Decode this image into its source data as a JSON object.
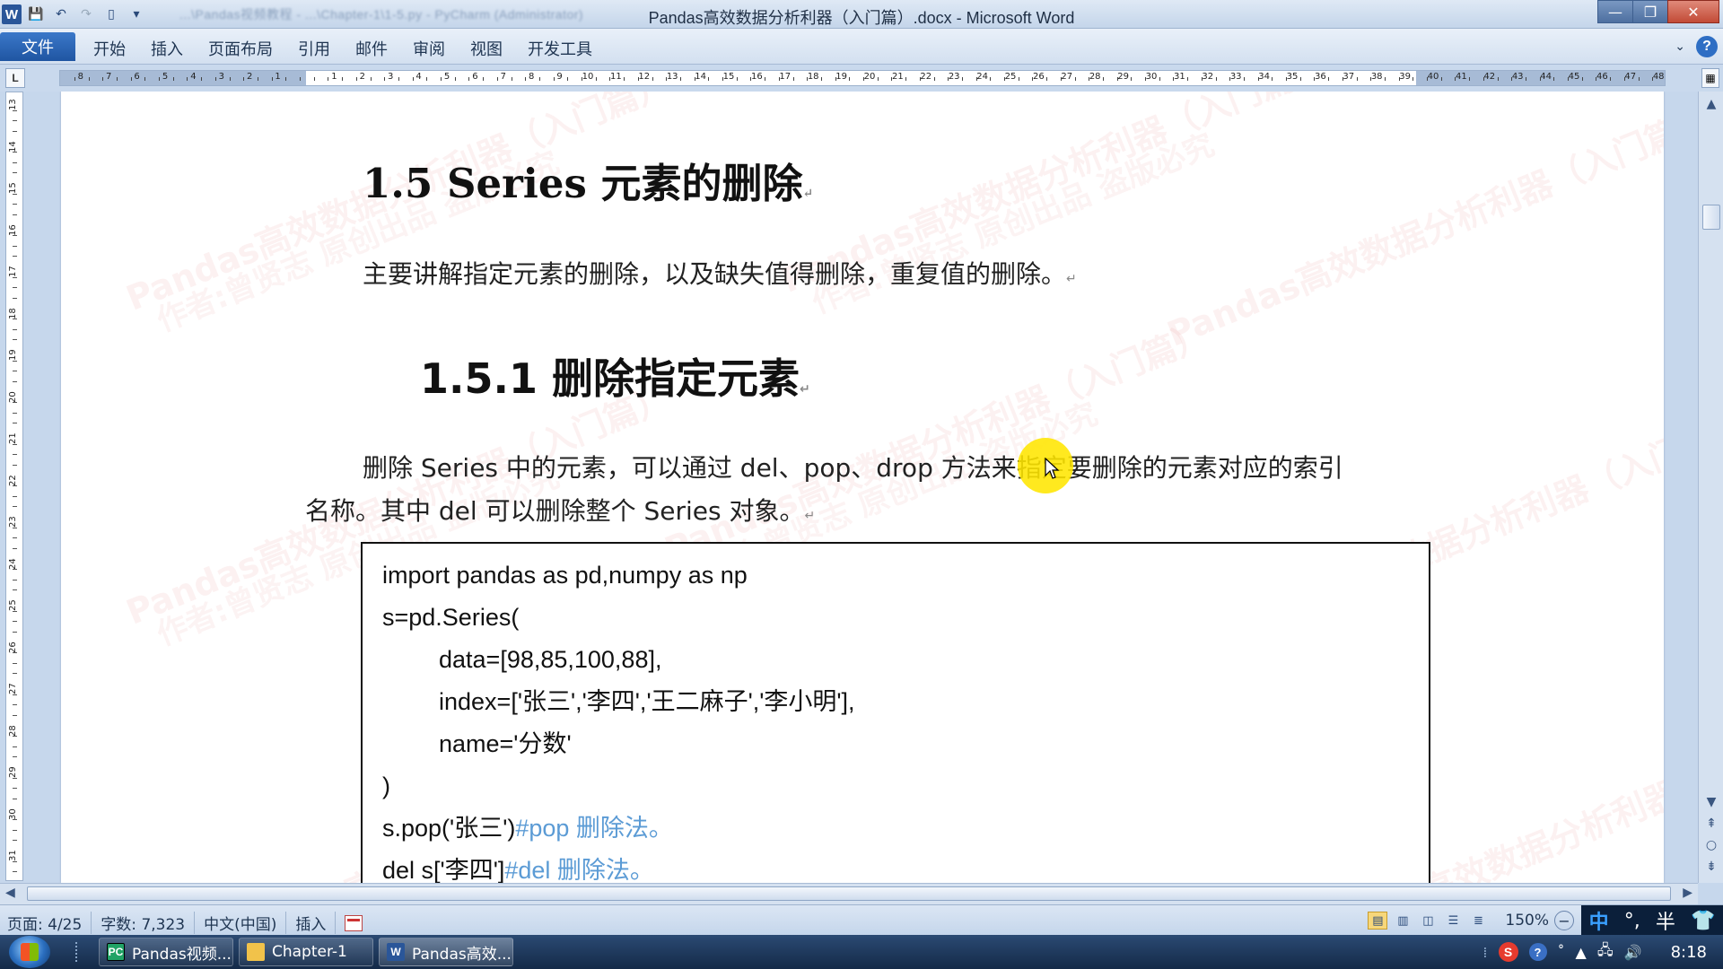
{
  "window": {
    "title": "Pandas高效数据分析利器（入门篇）.docx - Microsoft Word",
    "app_icon": "W",
    "qat_blurred_text": "...\\Pandas视频教程 - ...\\Chapter-1\\1-5.py - PyCharm (Administrator)"
  },
  "ribbon": {
    "file_tab": "文件",
    "tabs": [
      "开始",
      "插入",
      "页面布局",
      "引用",
      "邮件",
      "审阅",
      "视图",
      "开发工具"
    ]
  },
  "ruler": {
    "corner_label": "L",
    "h_left_labels": [
      "8",
      "7",
      "6",
      "5",
      "4",
      "3",
      "2",
      "1"
    ],
    "h_right_labels": [
      "1",
      "2",
      "3",
      "4",
      "5",
      "6",
      "7",
      "8",
      "9",
      "10",
      "11",
      "12",
      "13",
      "14",
      "15",
      "16",
      "17",
      "18",
      "19",
      "20",
      "21",
      "22",
      "23",
      "24",
      "25",
      "26",
      "27",
      "28",
      "29",
      "30",
      "31",
      "32",
      "33",
      "34",
      "35",
      "36",
      "37",
      "38",
      "39",
      "40",
      "41",
      "42",
      "43",
      "44",
      "45",
      "46",
      "47",
      "48"
    ],
    "v_labels": [
      "13",
      "14",
      "15",
      "16",
      "17",
      "18",
      "19",
      "20",
      "21",
      "22",
      "23",
      "24",
      "25",
      "26",
      "27",
      "28",
      "29",
      "30",
      "31"
    ]
  },
  "document": {
    "heading1": "1.5 Series 元素的删除",
    "intro": "主要讲解指定元素的删除，以及缺失值得删除，重复值的删除。",
    "heading2": "1.5.1 删除指定元素",
    "body_line1": "删除 Series 中的元素，可以通过 del、pop、drop 方法来指定要删除的元素对应的索引",
    "body_line2": "名称。其中 del 可以删除整个 Series 对象。",
    "paragraph_mark": "↵",
    "code": {
      "l1": "import pandas as pd,numpy as np",
      "l2": "s=pd.Series(",
      "l3": "data=[98,85,100,88],",
      "l4": "index=['张三','李四','王二麻子','李小明'],",
      "l5": "name='分数'",
      "l6": ")",
      "l7_code": "s.pop('张三')",
      "l7_comment": "#pop 删除法。",
      "l8_code": "del s['李四']",
      "l8_comment": "#del 删除法。"
    },
    "watermarks": {
      "line1": "Pandas高效数据分析利器（入门篇）",
      "line2": "作者:曾贤志  原创出品  盗版必究"
    }
  },
  "statusbar": {
    "page": "页面: 4/25",
    "words": "字数: 7,323",
    "language": "中文(中国)",
    "mode": "插入",
    "zoom": "150%",
    "ime_lang": "中",
    "ime_punct": "°,",
    "ime_width": "半"
  },
  "taskbar": {
    "items": [
      {
        "label": "Pandas视频...",
        "icon": "PC"
      },
      {
        "label": "Chapter-1",
        "icon": ""
      },
      {
        "label": "Pandas高效...",
        "icon": "W"
      }
    ],
    "clock": "8:18"
  },
  "colors": {
    "comment": "#5b9bd5",
    "highlight": "#ffe600",
    "ribbon_file": "#2b66b6"
  }
}
